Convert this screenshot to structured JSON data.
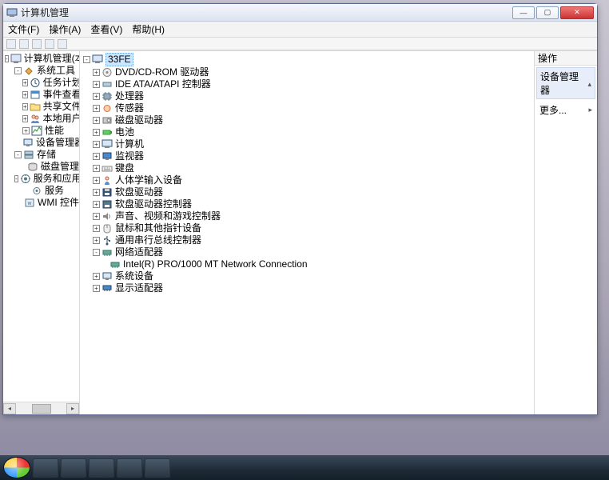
{
  "window": {
    "title": "计算机管理"
  },
  "menu": {
    "file": "文件(F)",
    "action": "操作(A)",
    "view": "查看(V)",
    "help": "帮助(H)"
  },
  "left": {
    "root": "计算机管理(本",
    "tools": "系统工具",
    "task": "任务计划程",
    "event": "事件查看器",
    "share": "共享文件夹",
    "users": "本地用户和",
    "perf": "性能",
    "devmgr": "设备管理器",
    "storage": "存储",
    "diskmgr": "磁盘管理",
    "services_apps": "服务和应用程",
    "services": "服务",
    "wmi": "WMI 控件"
  },
  "mid": {
    "computer": "33FE",
    "dvd": "DVD/CD-ROM 驱动器",
    "ide": "IDE ATA/ATAPI 控制器",
    "cpu": "处理器",
    "sensor": "传感器",
    "diskdrive": "磁盘驱动器",
    "battery": "电池",
    "computers": "计算机",
    "monitor": "监视器",
    "keyboard": "键盘",
    "hid": "人体学输入设备",
    "floppy": "软盘驱动器",
    "floppyctl": "软盘驱动器控制器",
    "sound": "声音、视频和游戏控制器",
    "mouse": "鼠标和其他指针设备",
    "usb": "通用串行总线控制器",
    "net": "网络适配器",
    "netitem": "Intel(R) PRO/1000 MT Network Connection",
    "sys": "系统设备",
    "display": "显示适配器"
  },
  "right": {
    "head": "操作",
    "band": "设备管理器",
    "more": "更多..."
  }
}
